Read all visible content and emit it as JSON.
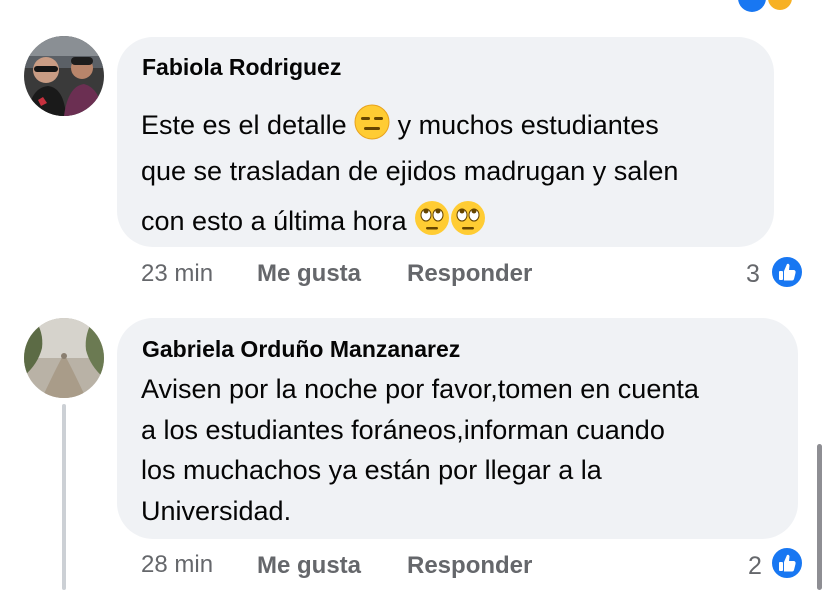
{
  "comments": [
    {
      "author": "Fabiola Rodriguez",
      "text_line1_a": "Este es el detalle",
      "text_line1_b": "y muchos estudiantes",
      "text_line2": "que se trasladan de ejidos madrugan y salen",
      "text_line3": "con esto a última hora",
      "emoji_1": "expressionless-face-icon",
      "emoji_2": "eye-roll-face-icon",
      "time": "23 min",
      "like_label": "Me gusta",
      "reply_label": "Responder",
      "like_count": "3"
    },
    {
      "author": "Gabriela Orduño Manzanarez",
      "lines": [
        "Avisen por la noche por favor,tomen en cuenta",
        "a los estudiantes foráneos,informan cuando",
        "los muchachos ya están por llegar a la",
        "Universidad."
      ],
      "time": "28 min",
      "like_label": "Me gusta",
      "reply_label": "Responder",
      "like_count": "2"
    }
  ],
  "colors": {
    "bubble": "#f0f2f5",
    "secondary_text": "#65676b",
    "like_blue": "#1877f2",
    "thread_line": "#ccd0d5"
  }
}
